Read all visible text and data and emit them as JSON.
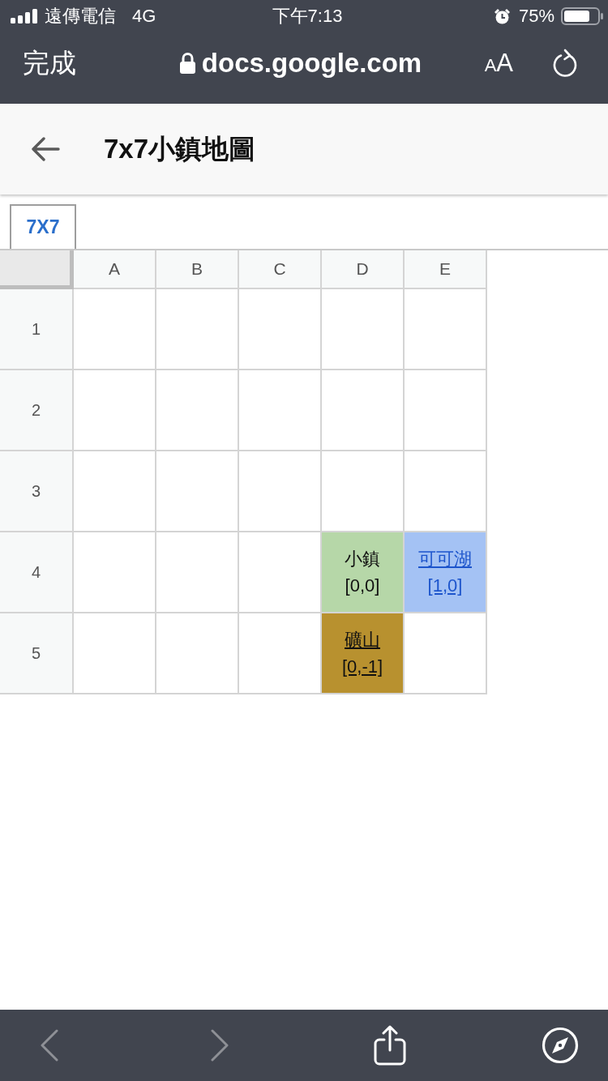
{
  "status_bar": {
    "carrier": "遠傳電信",
    "network": "4G",
    "time": "下午7:13",
    "battery_percent": "75%"
  },
  "browser_bar": {
    "done_button": "完成",
    "address": "docs.google.com",
    "text_size_button": {
      "small": "A",
      "large": "A"
    }
  },
  "document": {
    "title": "7x7小鎮地圖"
  },
  "sheet_tabs": [
    {
      "label": "7X7",
      "selected": true
    }
  ],
  "grid": {
    "columns": [
      "A",
      "B",
      "C",
      "D",
      "E"
    ],
    "rows": [
      {
        "label": "1",
        "cells": [
          null,
          null,
          null,
          null,
          null
        ]
      },
      {
        "label": "2",
        "cells": [
          null,
          null,
          null,
          null,
          null
        ]
      },
      {
        "label": "3",
        "cells": [
          null,
          null,
          null,
          null,
          null
        ]
      },
      {
        "label": "4",
        "cells": [
          null,
          null,
          null,
          {
            "kind": "text",
            "text": "小鎮\n[0,0]",
            "color": "#b6d7a8"
          },
          {
            "kind": "link",
            "text": "可可湖\n[1,0]",
            "color": "#a4c2f4"
          }
        ]
      },
      {
        "label": "5",
        "cells": [
          null,
          null,
          null,
          {
            "kind": "underlined",
            "text": "礦山\n[0,-1]",
            "color": "#b8912f"
          },
          null
        ]
      }
    ]
  },
  "bottom_toolbar": [
    {
      "kind": "back",
      "disabled": true
    },
    {
      "kind": "forward",
      "disabled": true
    },
    {
      "kind": "share",
      "disabled": false
    },
    {
      "kind": "compass",
      "disabled": false
    }
  ]
}
